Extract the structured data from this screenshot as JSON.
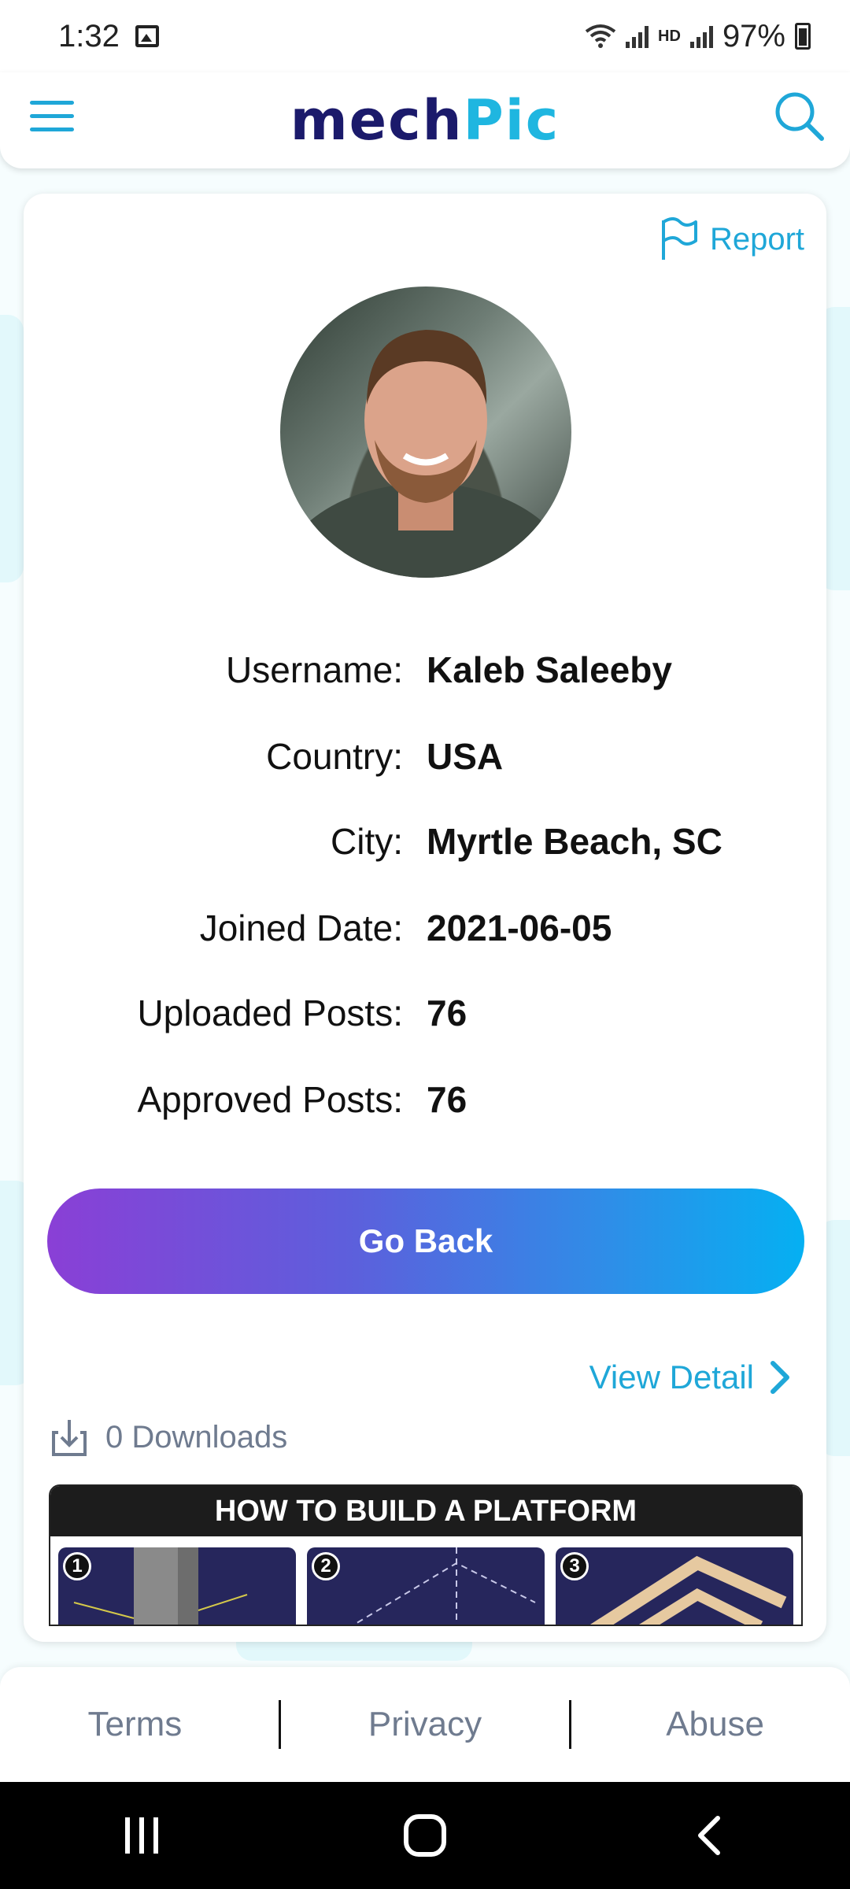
{
  "status_bar": {
    "time": "1:32",
    "battery": "97%",
    "network": "HD"
  },
  "header": {
    "logo_part1": "mech",
    "logo_part2": "Pic"
  },
  "card": {
    "report_label": "Report",
    "profile": [
      {
        "label": "Username:",
        "value": "Kaleb Saleeby"
      },
      {
        "label": "Country:",
        "value": "USA"
      },
      {
        "label": "City:",
        "value": "Myrtle Beach, SC"
      },
      {
        "label": "Joined Date:",
        "value": "2021-06-05"
      },
      {
        "label": "Uploaded Posts:",
        "value": "76"
      },
      {
        "label": "Approved Posts:",
        "value": "76"
      }
    ],
    "go_back_label": "Go Back",
    "view_detail_label": "View Detail",
    "downloads_label": "0 Downloads",
    "post": {
      "title": "HOW TO BUILD A PLATFORM",
      "steps": [
        "1",
        "2",
        "3"
      ]
    }
  },
  "footer": {
    "terms": "Terms",
    "privacy": "Privacy",
    "abuse": "Abuse"
  },
  "colors": {
    "accent": "#1fa7d8",
    "logo_dark": "#1b1a6b",
    "logo_light": "#1fb6e0",
    "gradient_start": "#8a3fd6",
    "gradient_end": "#05b0f2"
  }
}
